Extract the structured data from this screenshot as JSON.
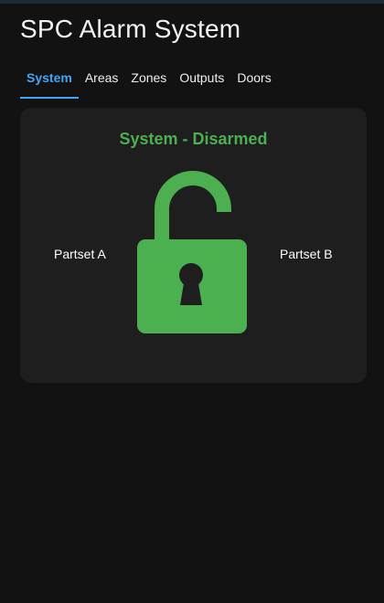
{
  "app": {
    "title": "SPC Alarm System"
  },
  "tabs": [
    {
      "label": "System",
      "active": true
    },
    {
      "label": "Areas",
      "active": false
    },
    {
      "label": "Zones",
      "active": false
    },
    {
      "label": "Outputs",
      "active": false
    },
    {
      "label": "Doors",
      "active": false
    }
  ],
  "system_card": {
    "status": "System - Disarmed",
    "status_color": "#4caf50",
    "lock_icon": "unlocked-padlock-icon",
    "lock_color": "#4caf50",
    "left_label": "Partset A",
    "right_label": "Partset B"
  },
  "theme": {
    "background": "#121212",
    "card": "#1e1e1e",
    "accent": "#3ea8f5"
  }
}
